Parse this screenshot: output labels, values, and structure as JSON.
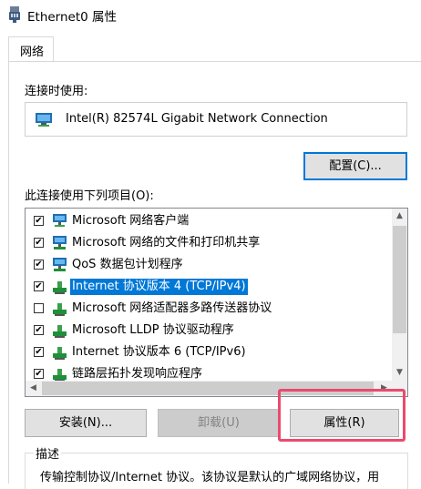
{
  "window": {
    "title": "Ethernet0 属性"
  },
  "tabs": [
    {
      "label": "网络"
    }
  ],
  "connect_using_label": "连接时使用:",
  "adapter": {
    "name": "Intel(R) 82574L Gigabit Network Connection",
    "icon": "network-adapter-icon"
  },
  "configure_button": "配置(C)...",
  "items_label": "此连接使用下列项目(O):",
  "items": [
    {
      "label": "Microsoft 网络客户端",
      "checked": true,
      "selected": false,
      "icon": "network-client-icon"
    },
    {
      "label": "Microsoft 网络的文件和打印机共享",
      "checked": true,
      "selected": false,
      "icon": "network-service-icon"
    },
    {
      "label": "QoS 数据包计划程序",
      "checked": true,
      "selected": false,
      "icon": "network-service-icon"
    },
    {
      "label": "Internet 协议版本 4 (TCP/IPv4)",
      "checked": true,
      "selected": true,
      "icon": "protocol-icon"
    },
    {
      "label": "Microsoft 网络适配器多路传送器协议",
      "checked": false,
      "selected": false,
      "icon": "protocol-icon"
    },
    {
      "label": "Microsoft LLDP 协议驱动程序",
      "checked": true,
      "selected": false,
      "icon": "protocol-icon"
    },
    {
      "label": "Internet 协议版本 6 (TCP/IPv6)",
      "checked": true,
      "selected": false,
      "icon": "protocol-icon"
    },
    {
      "label": "链路层拓扑发现响应程序",
      "checked": true,
      "selected": false,
      "icon": "protocol-icon"
    }
  ],
  "buttons": {
    "install": "安装(N)...",
    "uninstall": "卸载(U)",
    "properties": "属性(R)"
  },
  "description": {
    "title": "描述",
    "text": "传输控制协议/Internet 协议。该协议是默认的广域网络协议，用"
  },
  "colors": {
    "selection": "#0078d7",
    "highlight": "#ea4a6d"
  }
}
